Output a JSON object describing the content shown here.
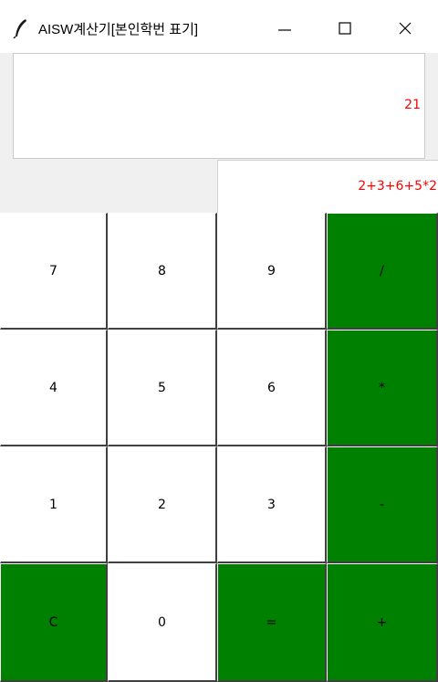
{
  "window": {
    "title": "AISW계산기[본인학번 표기]",
    "icons": [
      "feather-icon",
      "minimize-icon",
      "maximize-icon",
      "close-icon"
    ]
  },
  "display": {
    "result": "21",
    "expression": "2+3+6+5*2"
  },
  "keys": {
    "row1": [
      "7",
      "8",
      "9",
      "/"
    ],
    "row2": [
      "4",
      "5",
      "6",
      "*"
    ],
    "row3": [
      "1",
      "2",
      "3",
      "-"
    ],
    "row4": [
      "C",
      "0",
      "=",
      "+"
    ]
  },
  "colors": {
    "operator_key_bg": "#008000",
    "number_key_bg": "#ffffff",
    "display_text": "#ff0000"
  }
}
